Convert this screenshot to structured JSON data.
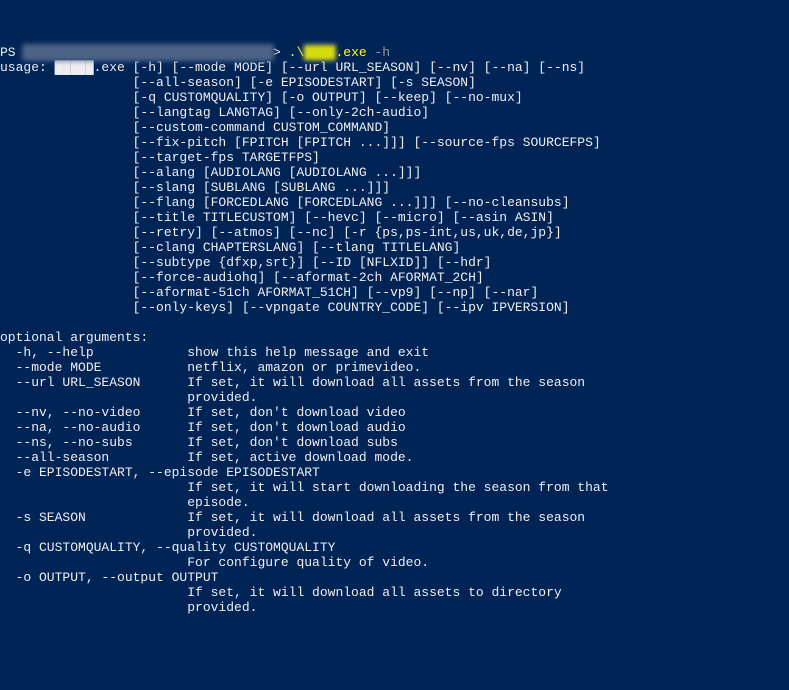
{
  "prompt": {
    "prefix": "PS ",
    "blurred_path": "████████████████████████████████",
    "gt": "> ",
    "cmd_prefix": ".\\",
    "cmd_blur": "████",
    "cmd_suffix": ".exe",
    "param": " -h"
  },
  "usage_lines": [
    "usage: █████.exe [-h] [--mode MODE] [--url URL_SEASON] [--nv] [--na] [--ns]",
    "                 [--all-season] [-e EPISODESTART] [-s SEASON]",
    "                 [-q CUSTOMQUALITY] [-o OUTPUT] [--keep] [--no-mux]",
    "                 [--langtag LANGTAG] [--only-2ch-audio]",
    "                 [--custom-command CUSTOM_COMMAND]",
    "                 [--fix-pitch [FPITCH [FPITCH ...]]] [--source-fps SOURCEFPS]",
    "                 [--target-fps TARGETFPS]",
    "                 [--alang [AUDIOLANG [AUDIOLANG ...]]]",
    "                 [--slang [SUBLANG [SUBLANG ...]]]",
    "                 [--flang [FORCEDLANG [FORCEDLANG ...]]] [--no-cleansubs]",
    "                 [--title TITLECUSTOM] [--hevc] [--micro] [--asin ASIN]",
    "                 [--retry] [--atmos] [--nc] [-r {ps,ps-int,us,uk,de,jp}]",
    "                 [--clang CHAPTERSLANG] [--tlang TITLELANG]",
    "                 [--subtype {dfxp,srt}] [--ID [NFLXID]] [--hdr]",
    "                 [--force-audiohq] [--aformat-2ch AFORMAT_2CH]",
    "                 [--aformat-51ch AFORMAT_51CH] [--vp9] [--np] [--nar]",
    "                 [--only-keys] [--vpngate COUNTRY_CODE] [--ipv IPVERSION]",
    ""
  ],
  "optional_header": "optional arguments:",
  "args": [
    {
      "flag": "  -h, --help",
      "pad": "            ",
      "desc": "show this help message and exit"
    },
    {
      "flag": "  --mode MODE",
      "pad": "           ",
      "desc": "netflix, amazon or primevideo."
    },
    {
      "flag": "  --url URL_SEASON",
      "pad": "      ",
      "desc": "If set, it will download all assets from the season"
    },
    {
      "flag": "",
      "pad": "                        ",
      "desc": "provided."
    },
    {
      "flag": "  --nv, --no-video",
      "pad": "      ",
      "desc": "If set, don't download video"
    },
    {
      "flag": "  --na, --no-audio",
      "pad": "      ",
      "desc": "If set, don't download audio"
    },
    {
      "flag": "  --ns, --no-subs",
      "pad": "       ",
      "desc": "If set, don't download subs"
    },
    {
      "flag": "  --all-season",
      "pad": "          ",
      "desc": "If set, active download mode."
    },
    {
      "flag": "  -e EPISODESTART, --episode EPISODESTART",
      "pad": "",
      "desc": ""
    },
    {
      "flag": "",
      "pad": "                        ",
      "desc": "If set, it will start downloading the season from that"
    },
    {
      "flag": "",
      "pad": "                        ",
      "desc": "episode."
    },
    {
      "flag": "  -s SEASON",
      "pad": "             ",
      "desc": "If set, it will download all assets from the season"
    },
    {
      "flag": "",
      "pad": "                        ",
      "desc": "provided."
    },
    {
      "flag": "  -q CUSTOMQUALITY, --quality CUSTOMQUALITY",
      "pad": "",
      "desc": ""
    },
    {
      "flag": "",
      "pad": "                        ",
      "desc": "For configure quality of video."
    },
    {
      "flag": "  -o OUTPUT, --output OUTPUT",
      "pad": "",
      "desc": ""
    },
    {
      "flag": "",
      "pad": "                        ",
      "desc": "If set, it will download all assets to directory"
    },
    {
      "flag": "",
      "pad": "                        ",
      "desc": "provided."
    }
  ]
}
